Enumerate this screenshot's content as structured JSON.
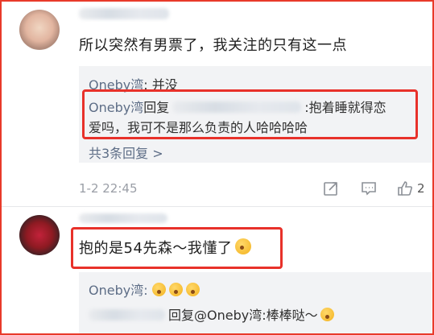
{
  "comment1": {
    "text": "所以突然有男票了，我关注的只有这一点",
    "replies": [
      {
        "user": "Oneby湾",
        "text": ": 并没"
      },
      {
        "user": "Oneby湾",
        "reply_word": "回复",
        "text_line1": ":抱着睡就得恋",
        "text_line2": "爱吗，我可不是那么负责的人哈哈哈哈"
      }
    ],
    "more_replies": "共3条回复 >",
    "timestamp": "1-2 22:45",
    "like_count": "2"
  },
  "comment2": {
    "text": "抱的是54先森～我懂了",
    "replies": [
      {
        "user": "Oneby湾:"
      },
      {
        "reply_prefix": "回复@Oneby湾:棒棒哒～"
      }
    ]
  },
  "icons": {
    "share": "share-icon",
    "comment": "comment-icon",
    "like": "thumbs-up-icon"
  },
  "colors": {
    "highlight_border": "#e8312a",
    "username": "#5d6d86",
    "reply_background": "#f2f3f5"
  }
}
